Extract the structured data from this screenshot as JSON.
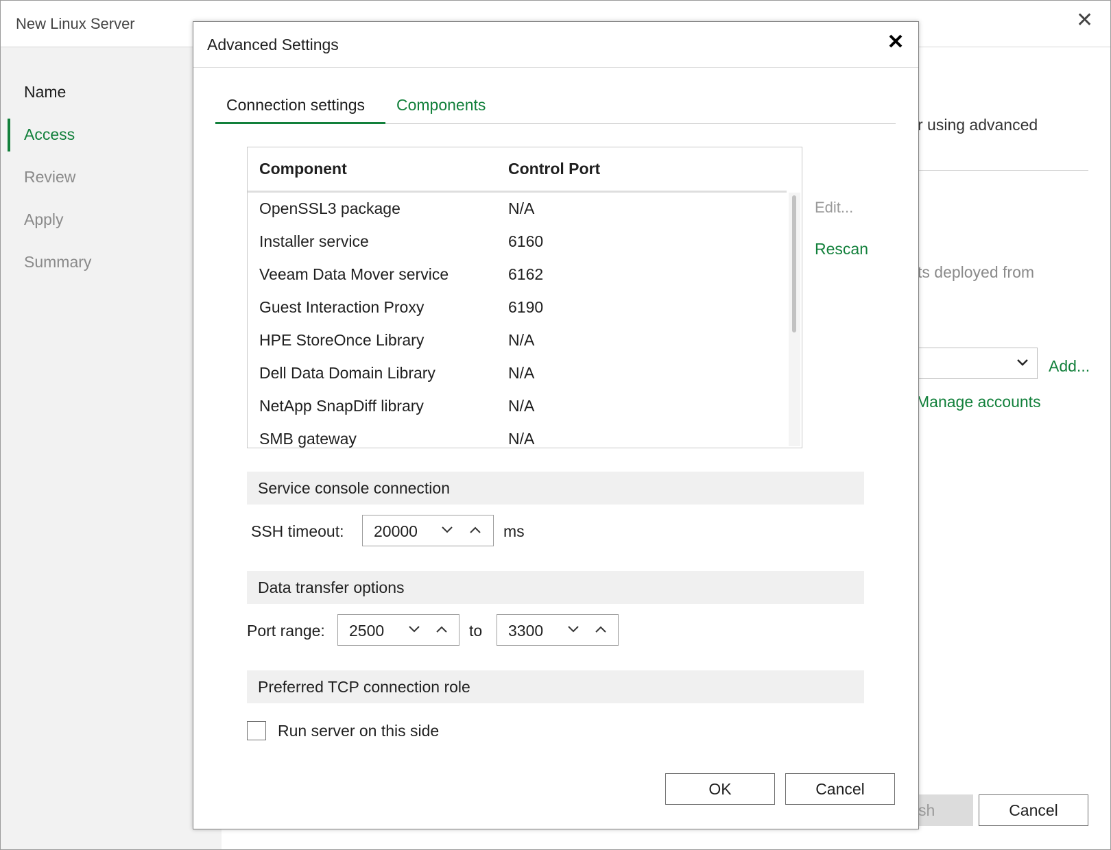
{
  "wizard": {
    "title": "New Linux Server",
    "steps": [
      "Name",
      "Access",
      "Review",
      "Apply",
      "Summary"
    ],
    "text_advanced": "r using advanced",
    "text_deployed": "ts deployed from",
    "add_label": "Add...",
    "manage_accounts_label": "Manage accounts",
    "finish_partial": "sh",
    "cancel_label": "Cancel",
    "accent_color": "#12803b"
  },
  "dialog": {
    "title": "Advanced Settings",
    "tabs": [
      {
        "label": "Connection settings",
        "active": true
      },
      {
        "label": "Components",
        "active": false
      }
    ],
    "table": {
      "headers": [
        "Component",
        "Control Port"
      ],
      "rows": [
        {
          "component": "OpenSSL3 package",
          "port": "N/A"
        },
        {
          "component": "Installer service",
          "port": "6160"
        },
        {
          "component": "Veeam Data Mover service",
          "port": "6162"
        },
        {
          "component": "Guest Interaction Proxy",
          "port": "6190"
        },
        {
          "component": "HPE StoreOnce Library",
          "port": "N/A"
        },
        {
          "component": "Dell Data Domain Library",
          "port": "N/A"
        },
        {
          "component": "NetApp SnapDiff library",
          "port": "N/A"
        },
        {
          "component": "SMB gateway",
          "port": "N/A"
        }
      ]
    },
    "edit_label": "Edit...",
    "rescan_label": "Rescan",
    "service_console": {
      "heading": "Service console connection",
      "ssh_timeout_label": "SSH timeout:",
      "ssh_timeout_value": "20000",
      "unit": "ms"
    },
    "data_transfer": {
      "heading": "Data transfer options",
      "port_range_label": "Port range:",
      "port_from": "2500",
      "to_label": "to",
      "port_to": "3300"
    },
    "tcp_role": {
      "heading": "Preferred TCP connection role",
      "run_server_label": "Run server on this side",
      "run_server_checked": false
    },
    "ok_label": "OK",
    "cancel_label": "Cancel"
  }
}
